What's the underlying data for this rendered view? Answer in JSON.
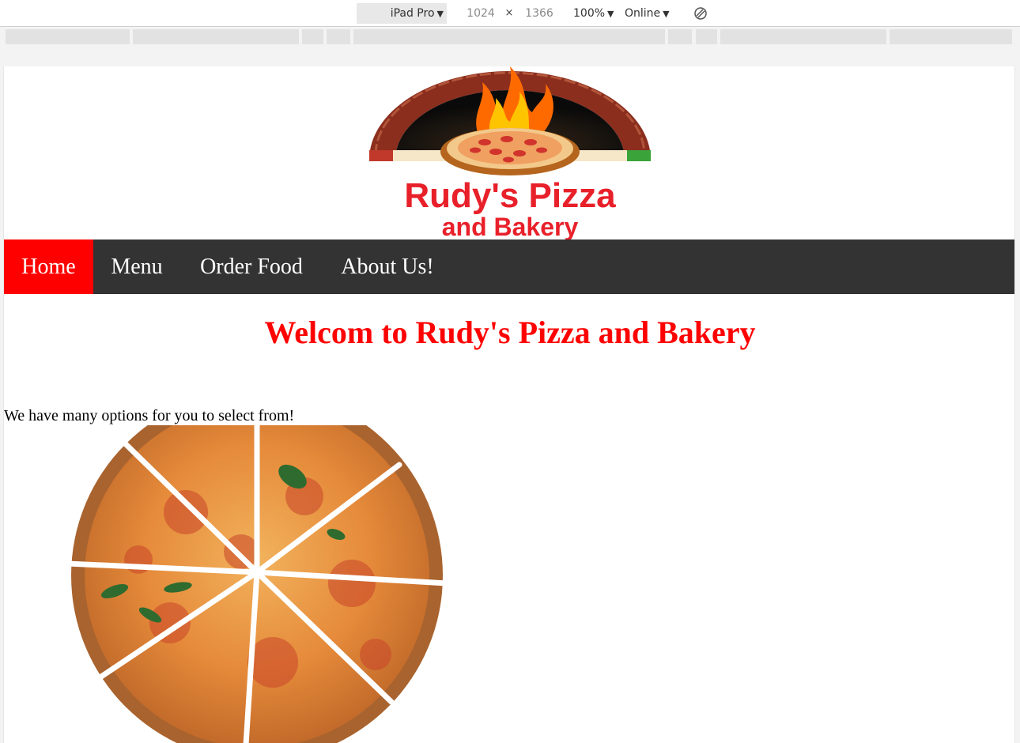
{
  "devtools": {
    "device": "iPad Pro",
    "width": "1024",
    "times": "×",
    "height": "1366",
    "zoom": "100%",
    "network": "Online",
    "caret": "▼"
  },
  "logo": {
    "line1": "Rudy's Pizza",
    "line2": "and Bakery"
  },
  "nav": {
    "items": [
      {
        "label": "Home",
        "active": true
      },
      {
        "label": "Menu",
        "active": false
      },
      {
        "label": "Order Food",
        "active": false
      },
      {
        "label": "About Us!",
        "active": false
      }
    ],
    "bg_color": "#333333",
    "active_color": "#ff0000"
  },
  "main": {
    "heading": "Welcom to Rudy's Pizza and Bakery",
    "intro": "We have many options for you to select from!"
  },
  "colors": {
    "accent": "#ff0000"
  },
  "icons": [
    "caret-down-icon",
    "rotate-icon",
    "pizza-oven-logo",
    "pizza-image"
  ]
}
